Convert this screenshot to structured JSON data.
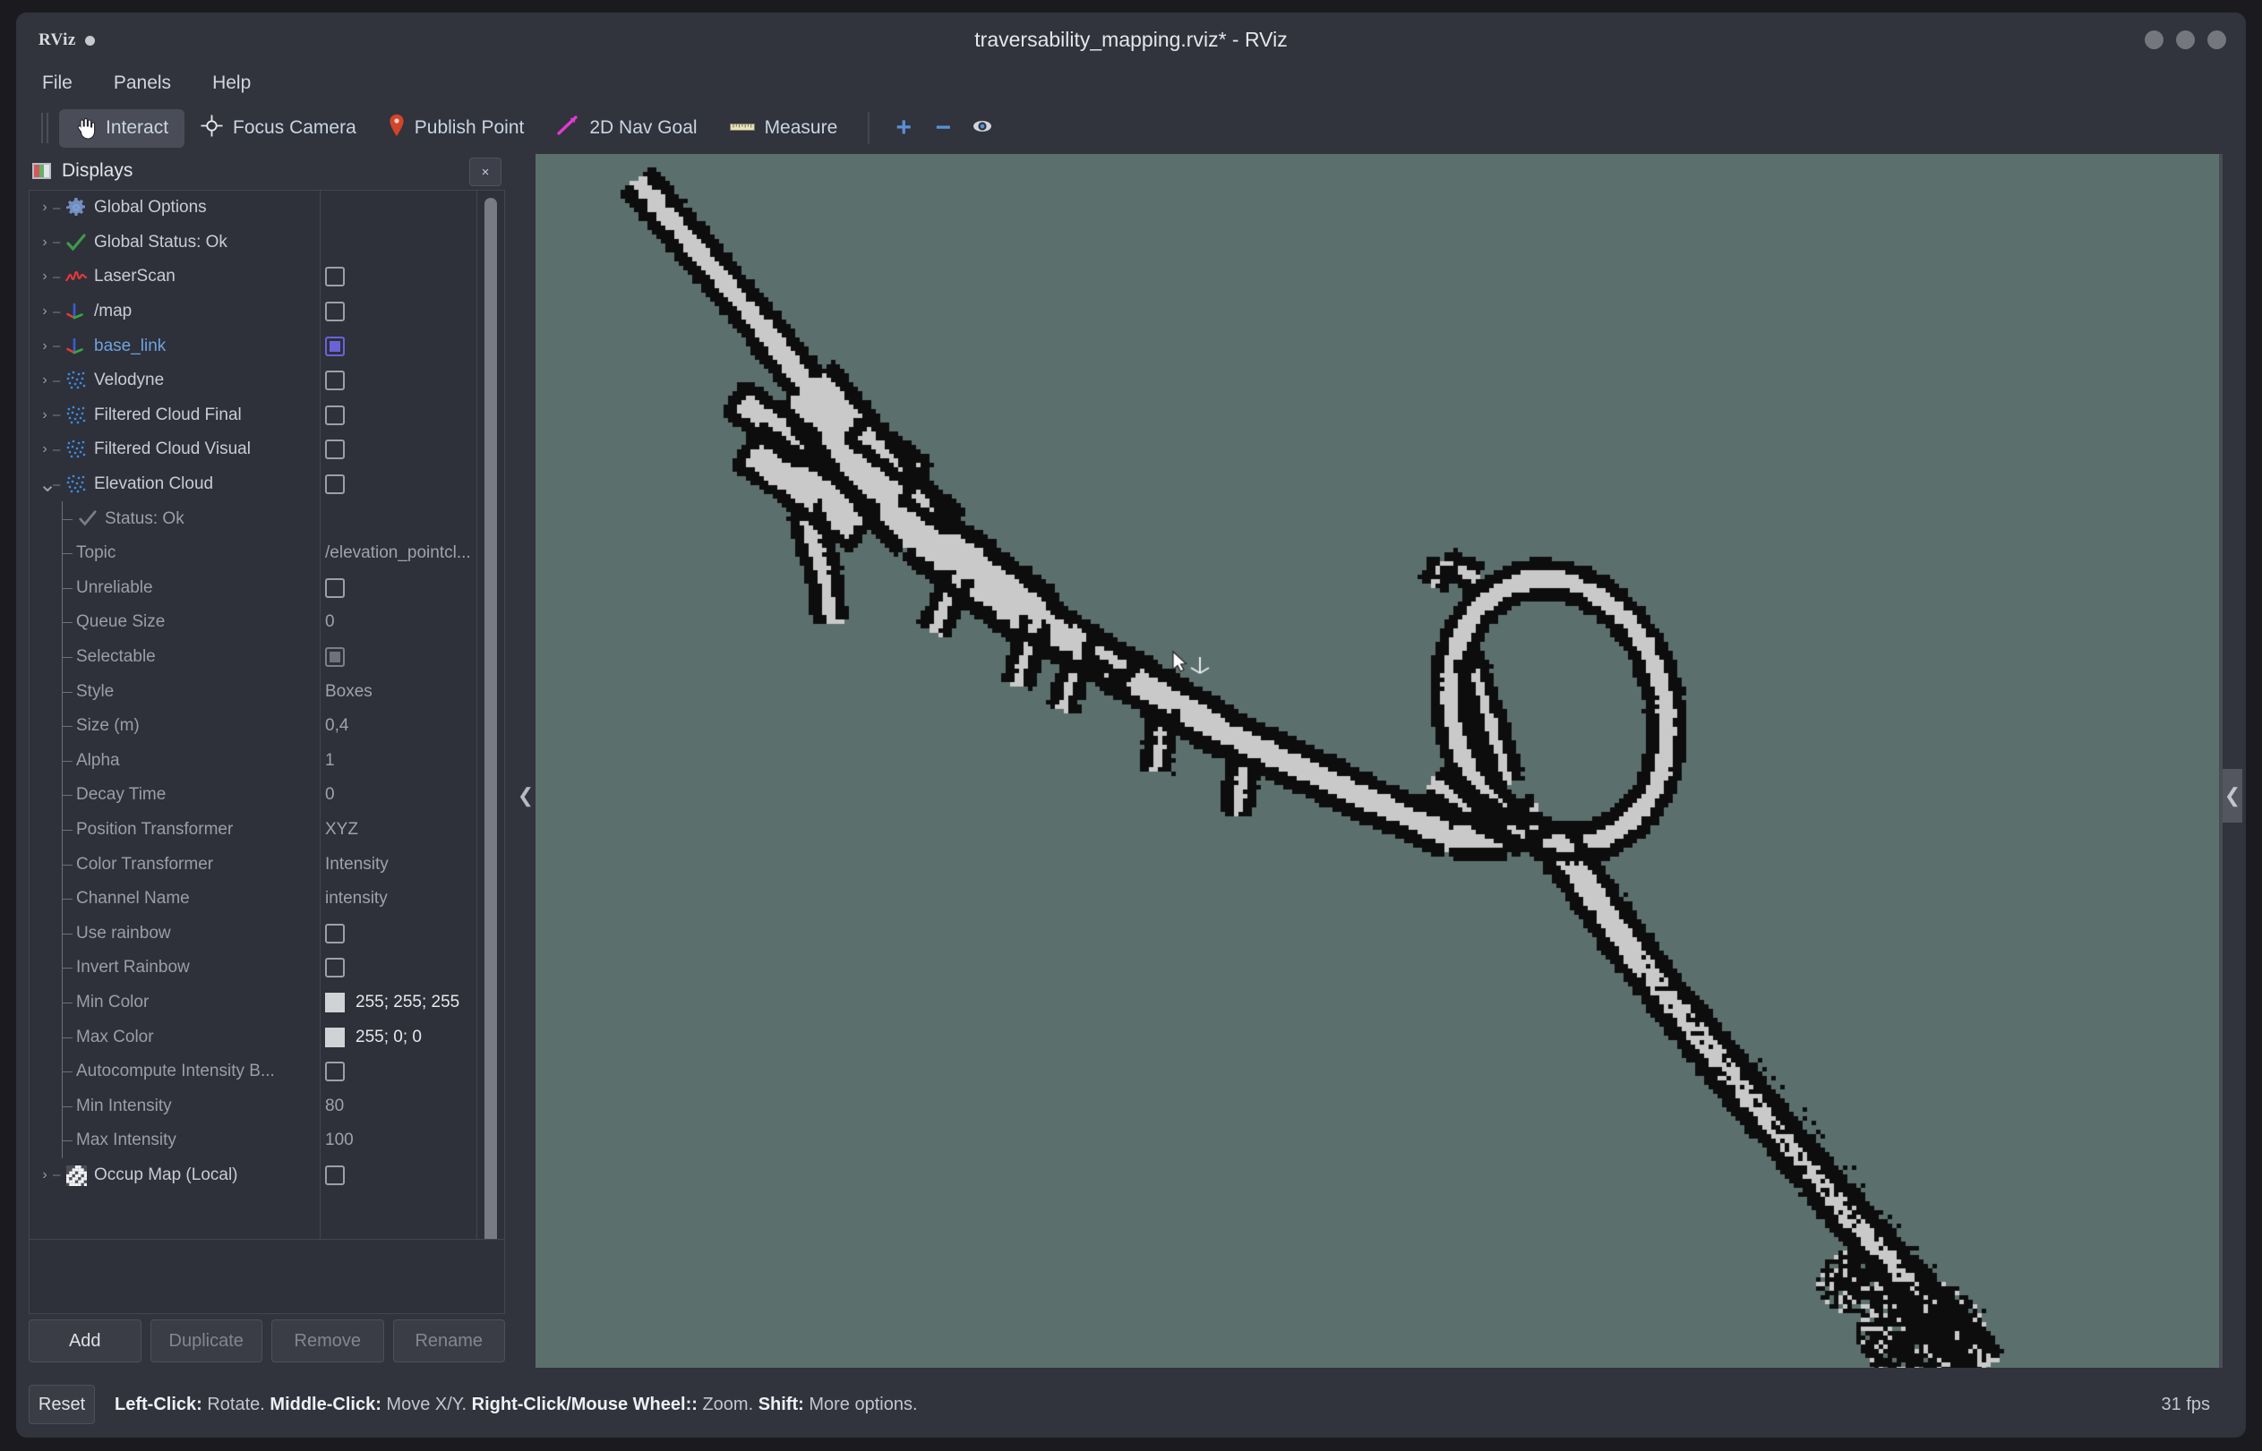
{
  "window": {
    "app_logo": "RViz",
    "title": "traversability_mapping.rviz* - RViz",
    "controls": [
      "minimize",
      "maximize",
      "close"
    ]
  },
  "menu": {
    "items": [
      "File",
      "Panels",
      "Help"
    ]
  },
  "toolbar": {
    "tools": [
      {
        "label": "Interact",
        "icon": "hand-cursor-icon",
        "active": true
      },
      {
        "label": "Focus Camera",
        "icon": "crosshair-icon",
        "active": false
      },
      {
        "label": "Publish Point",
        "icon": "map-pin-icon",
        "active": false
      },
      {
        "label": "2D Nav Goal",
        "icon": "magenta-arrow-icon",
        "active": false
      },
      {
        "label": "Measure",
        "icon": "ruler-icon",
        "active": false
      }
    ],
    "buttons": [
      {
        "name": "add-tool-button",
        "icon": "plus-icon",
        "label": "+"
      },
      {
        "name": "remove-tool-button",
        "icon": "minus-icon",
        "label": "−"
      },
      {
        "name": "tool-properties-button",
        "icon": "eye-icon",
        "label": ""
      }
    ]
  },
  "displays_panel": {
    "title": "Displays",
    "close_label": "×",
    "tree": [
      {
        "label": "Global Options",
        "icon": "gear-icon",
        "expander": "collapsed",
        "kind": "display",
        "value_type": "none"
      },
      {
        "label": "Global Status: Ok",
        "icon": "check-icon",
        "expander": "collapsed",
        "kind": "display",
        "value_type": "none"
      },
      {
        "label": "LaserScan",
        "icon": "laserscan-icon",
        "expander": "collapsed",
        "kind": "display",
        "value_type": "checkbox",
        "checked": false
      },
      {
        "label": "/map",
        "icon": "axes-icon",
        "expander": "collapsed",
        "kind": "display",
        "value_type": "checkbox",
        "checked": false
      },
      {
        "label": "base_link",
        "icon": "axes-icon",
        "expander": "collapsed",
        "kind": "display",
        "value_type": "checkbox",
        "checked": true,
        "selected": true
      },
      {
        "label": "Velodyne",
        "icon": "pointcloud-icon",
        "expander": "collapsed",
        "kind": "display",
        "value_type": "checkbox",
        "checked": false
      },
      {
        "label": "Filtered Cloud Final",
        "icon": "pointcloud-icon",
        "expander": "collapsed",
        "kind": "display",
        "value_type": "checkbox",
        "checked": false
      },
      {
        "label": "Filtered Cloud Visual",
        "icon": "pointcloud-icon",
        "expander": "collapsed",
        "kind": "display",
        "value_type": "checkbox",
        "checked": false
      },
      {
        "label": "Elevation Cloud",
        "icon": "pointcloud-icon",
        "expander": "expanded",
        "kind": "display",
        "value_type": "checkbox",
        "checked": false
      },
      {
        "label": "Status: Ok",
        "icon": "check-dim-icon",
        "kind": "status",
        "value_type": "none"
      },
      {
        "label": "Topic",
        "kind": "prop",
        "value_type": "text",
        "value": "/elevation_pointcl..."
      },
      {
        "label": "Unreliable",
        "kind": "prop",
        "value_type": "checkbox",
        "checked": false
      },
      {
        "label": "Queue Size",
        "kind": "prop",
        "value_type": "text",
        "value": "0"
      },
      {
        "label": "Selectable",
        "kind": "prop",
        "value_type": "checkbox-filled",
        "checked": true
      },
      {
        "label": "Style",
        "kind": "prop",
        "value_type": "text",
        "value": "Boxes"
      },
      {
        "label": "Size (m)",
        "kind": "prop",
        "value_type": "text",
        "value": "0,4"
      },
      {
        "label": "Alpha",
        "kind": "prop",
        "value_type": "text",
        "value": "1"
      },
      {
        "label": "Decay Time",
        "kind": "prop",
        "value_type": "text",
        "value": "0"
      },
      {
        "label": "Position Transformer",
        "kind": "prop",
        "value_type": "text",
        "value": "XYZ"
      },
      {
        "label": "Color Transformer",
        "kind": "prop",
        "value_type": "text",
        "value": "Intensity"
      },
      {
        "label": "Channel Name",
        "kind": "prop",
        "value_type": "text",
        "value": "intensity"
      },
      {
        "label": "Use rainbow",
        "kind": "prop",
        "value_type": "checkbox",
        "checked": false
      },
      {
        "label": "Invert Rainbow",
        "kind": "prop",
        "value_type": "checkbox",
        "checked": false
      },
      {
        "label": "Min Color",
        "kind": "prop",
        "value_type": "color",
        "value": "255; 255; 255",
        "swatch": "#d0d2d6"
      },
      {
        "label": "Max Color",
        "kind": "prop",
        "value_type": "color",
        "value": "255; 0; 0",
        "swatch": "#d0d2d6"
      },
      {
        "label": "Autocompute Intensity B...",
        "kind": "prop",
        "value_type": "checkbox",
        "checked": false
      },
      {
        "label": "Min Intensity",
        "kind": "prop",
        "value_type": "text",
        "value": "80"
      },
      {
        "label": "Max Intensity",
        "kind": "prop",
        "value_type": "text",
        "value": "100"
      },
      {
        "label": "Occup Map (Local)",
        "icon": "map-grid-icon",
        "expander": "collapsed",
        "kind": "display",
        "value_type": "checkbox",
        "checked": false
      }
    ],
    "buttons": [
      {
        "label": "Add",
        "enabled": true
      },
      {
        "label": "Duplicate",
        "enabled": false
      },
      {
        "label": "Remove",
        "enabled": false
      },
      {
        "label": "Rename",
        "enabled": false
      }
    ]
  },
  "viewport": {
    "background_color": "#5b706d",
    "free_space_color": "#c9c9c9",
    "occupied_color": "#0d0d0d",
    "collapse_left_icon": "chevron-left-icon",
    "collapse_right_icon": "chevron-left-icon"
  },
  "statusbar": {
    "reset_label": "Reset",
    "hint_parts": [
      {
        "text": "Left-Click:",
        "bold": true
      },
      {
        "text": " Rotate. ",
        "bold": false
      },
      {
        "text": "Middle-Click:",
        "bold": true
      },
      {
        "text": " Move X/Y. ",
        "bold": false
      },
      {
        "text": "Right-Click/Mouse Wheel::",
        "bold": true
      },
      {
        "text": " Zoom. ",
        "bold": false
      },
      {
        "text": "Shift:",
        "bold": true
      },
      {
        "text": " More options.",
        "bold": false
      }
    ],
    "fps": "31 fps"
  }
}
